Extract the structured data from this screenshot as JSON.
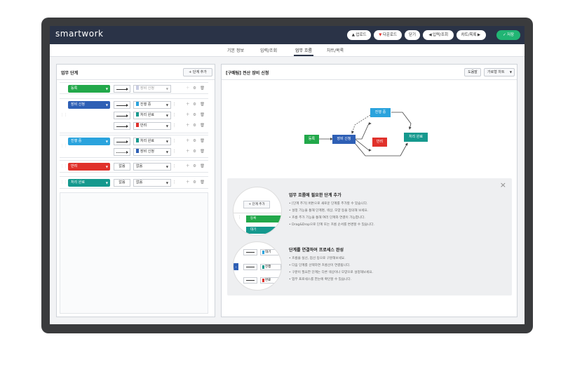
{
  "app": {
    "logo": "smartwork"
  },
  "toolbar": {
    "upload": "업로드",
    "upload_icon": "▲",
    "download": "다운로드",
    "download_icon": "▼",
    "close": "닫기",
    "input_query": "입력/조회",
    "input_query_icon": "◀",
    "chart_list": "차트/목록",
    "chart_list_icon": "▶",
    "save": "저장",
    "save_icon": "✓"
  },
  "tabs": [
    "기본 정보",
    "입력/조회",
    "업무 흐름",
    "차트/목록"
  ],
  "active_tab": "업무 흐름",
  "left_panel": {
    "title": "업무 단계",
    "add_step_button": "+ 단계 추가",
    "groups": [
      {
        "step": "등록",
        "color": "#22a84a",
        "rows": [
          {
            "arrow": "solid",
            "target": "장비 신청",
            "target_color": "#c9cde3",
            "dim": true
          }
        ]
      },
      {
        "step": "장비 신청",
        "color": "#2e5fb5",
        "rows": [
          {
            "arrow": "solid",
            "target": "진행 중",
            "target_color": "#2aa3dd"
          },
          {
            "arrow": "solid",
            "target": "처리 완료",
            "target_color": "#15998e"
          },
          {
            "arrow": "solid",
            "target": "반려",
            "target_color": "#e0312b"
          }
        ]
      },
      {
        "step": "진행 중",
        "color": "#2aa3dd",
        "rows": [
          {
            "arrow": "solid",
            "target": "처리 완료",
            "target_color": "#15998e"
          },
          {
            "arrow": "dotted",
            "target": "장비 신청",
            "target_color": "#2e5fb5"
          }
        ]
      },
      {
        "step": "반려",
        "color": "#e0312b",
        "rows": [
          {
            "arrow_text": "없음",
            "target": "없음"
          }
        ]
      },
      {
        "step": "처리 완료",
        "color": "#15998e",
        "rows": [
          {
            "arrow_text": "없음",
            "target": "없음"
          }
        ]
      }
    ]
  },
  "right_panel": {
    "title": "[구매팀] 전산 장비 신청",
    "help_button": "도움말",
    "layout_select": "가로형 차트",
    "diagram_nodes": [
      {
        "label": "등록",
        "color": "#22a84a"
      },
      {
        "label": "장비 신청",
        "color": "#2e5fb5"
      },
      {
        "label": "진행 중",
        "color": "#2aa3dd"
      },
      {
        "label": "반려",
        "color": "#e0312b"
      },
      {
        "label": "처리 완료",
        "color": "#15998e"
      }
    ]
  },
  "help": {
    "close_icon": "×",
    "section1": {
      "title": "업무 흐름에 필요한 단계 추가",
      "lines": [
        "• [단계 추가] 버튼으로 새로운 단계를 추가할 수 있습니다.",
        "• 설정 기능을 통해 단계명, 색상, 모양 등을 정의해 보세요.",
        "• 흐름 추가 기능을 통해 여러 단계와 연결이 가능합니다.",
        "• Drag&Drop으로 단계 또는 흐름 순서를 변경할 수 있습니다."
      ],
      "illus_button": "+ 단계 추가",
      "illus_pill": "등록",
      "illus_pill2": "대기"
    },
    "section2": {
      "title": "단계를 연결하여 프로세스 완성",
      "lines": [
        "• 흐름을 실선, 점선 등으로 구분해보세요.",
        "• 다음 단계를 선택하면 흐름선이 연결됩니다.",
        "• 구분이 필요한 단계는 다른 색상이나 모양으로 설정해보세요.",
        "• 업무 프로세스를 한눈에 확인할 수 있습니다."
      ],
      "illus_sel1": "대기",
      "illus_sel2": "진행",
      "illus_sel3": "완료"
    }
  }
}
